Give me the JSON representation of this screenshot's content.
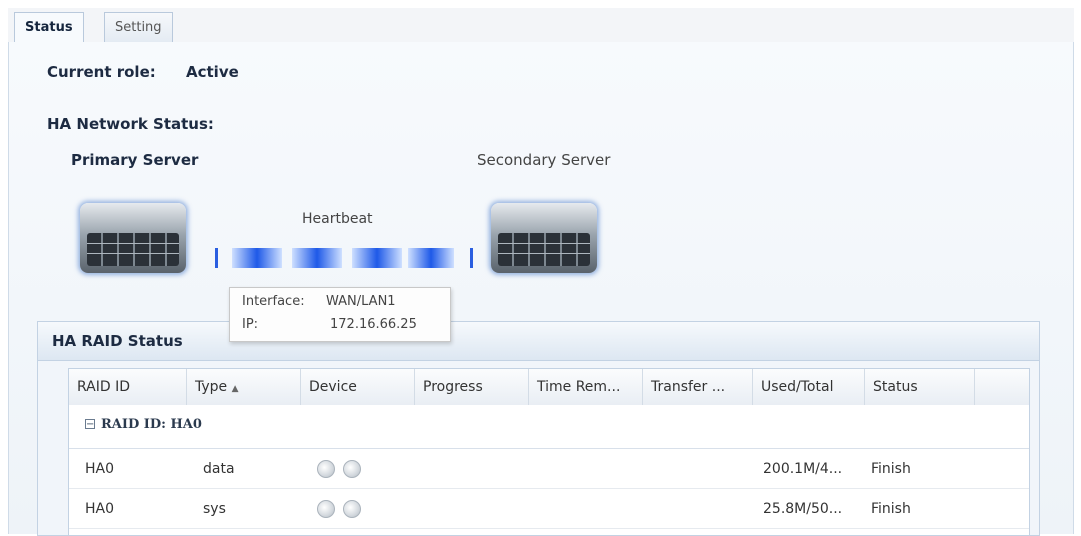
{
  "tabs": [
    {
      "label": "Status",
      "active": true
    },
    {
      "label": "Setting",
      "active": false
    }
  ],
  "status": {
    "current_role_label": "Current role:",
    "current_role_value": "Active",
    "ha_network_title": "HA Network Status:",
    "primary_label": "Primary Server",
    "secondary_label": "Secondary Server",
    "heartbeat_label": "Heartbeat"
  },
  "tooltip": {
    "interface_label": "Interface:",
    "interface_value": "WAN/LAN1",
    "ip_label": "IP:",
    "ip_value": "172.16.66.25"
  },
  "raid": {
    "title": "HA RAID Status",
    "columns": [
      "RAID ID",
      "Type",
      "Device",
      "Progress",
      "Time Rem...",
      "Transfer ...",
      "Used/Total",
      "Status"
    ],
    "sort_indicator": "▲",
    "group_label": "RAID ID: HA0",
    "rows": [
      {
        "raid_id": "HA0",
        "type": "data",
        "progress": "",
        "time_rem": "",
        "transfer": "",
        "used_total": "200.1M/4...",
        "status": "Finish"
      },
      {
        "raid_id": "HA0",
        "type": "sys",
        "progress": "",
        "time_rem": "",
        "transfer": "",
        "used_total": "25.8M/50...",
        "status": "Finish"
      }
    ]
  },
  "colors": {
    "accent_blue": "#1e59e8",
    "panel_border": "#c3d2e3"
  }
}
